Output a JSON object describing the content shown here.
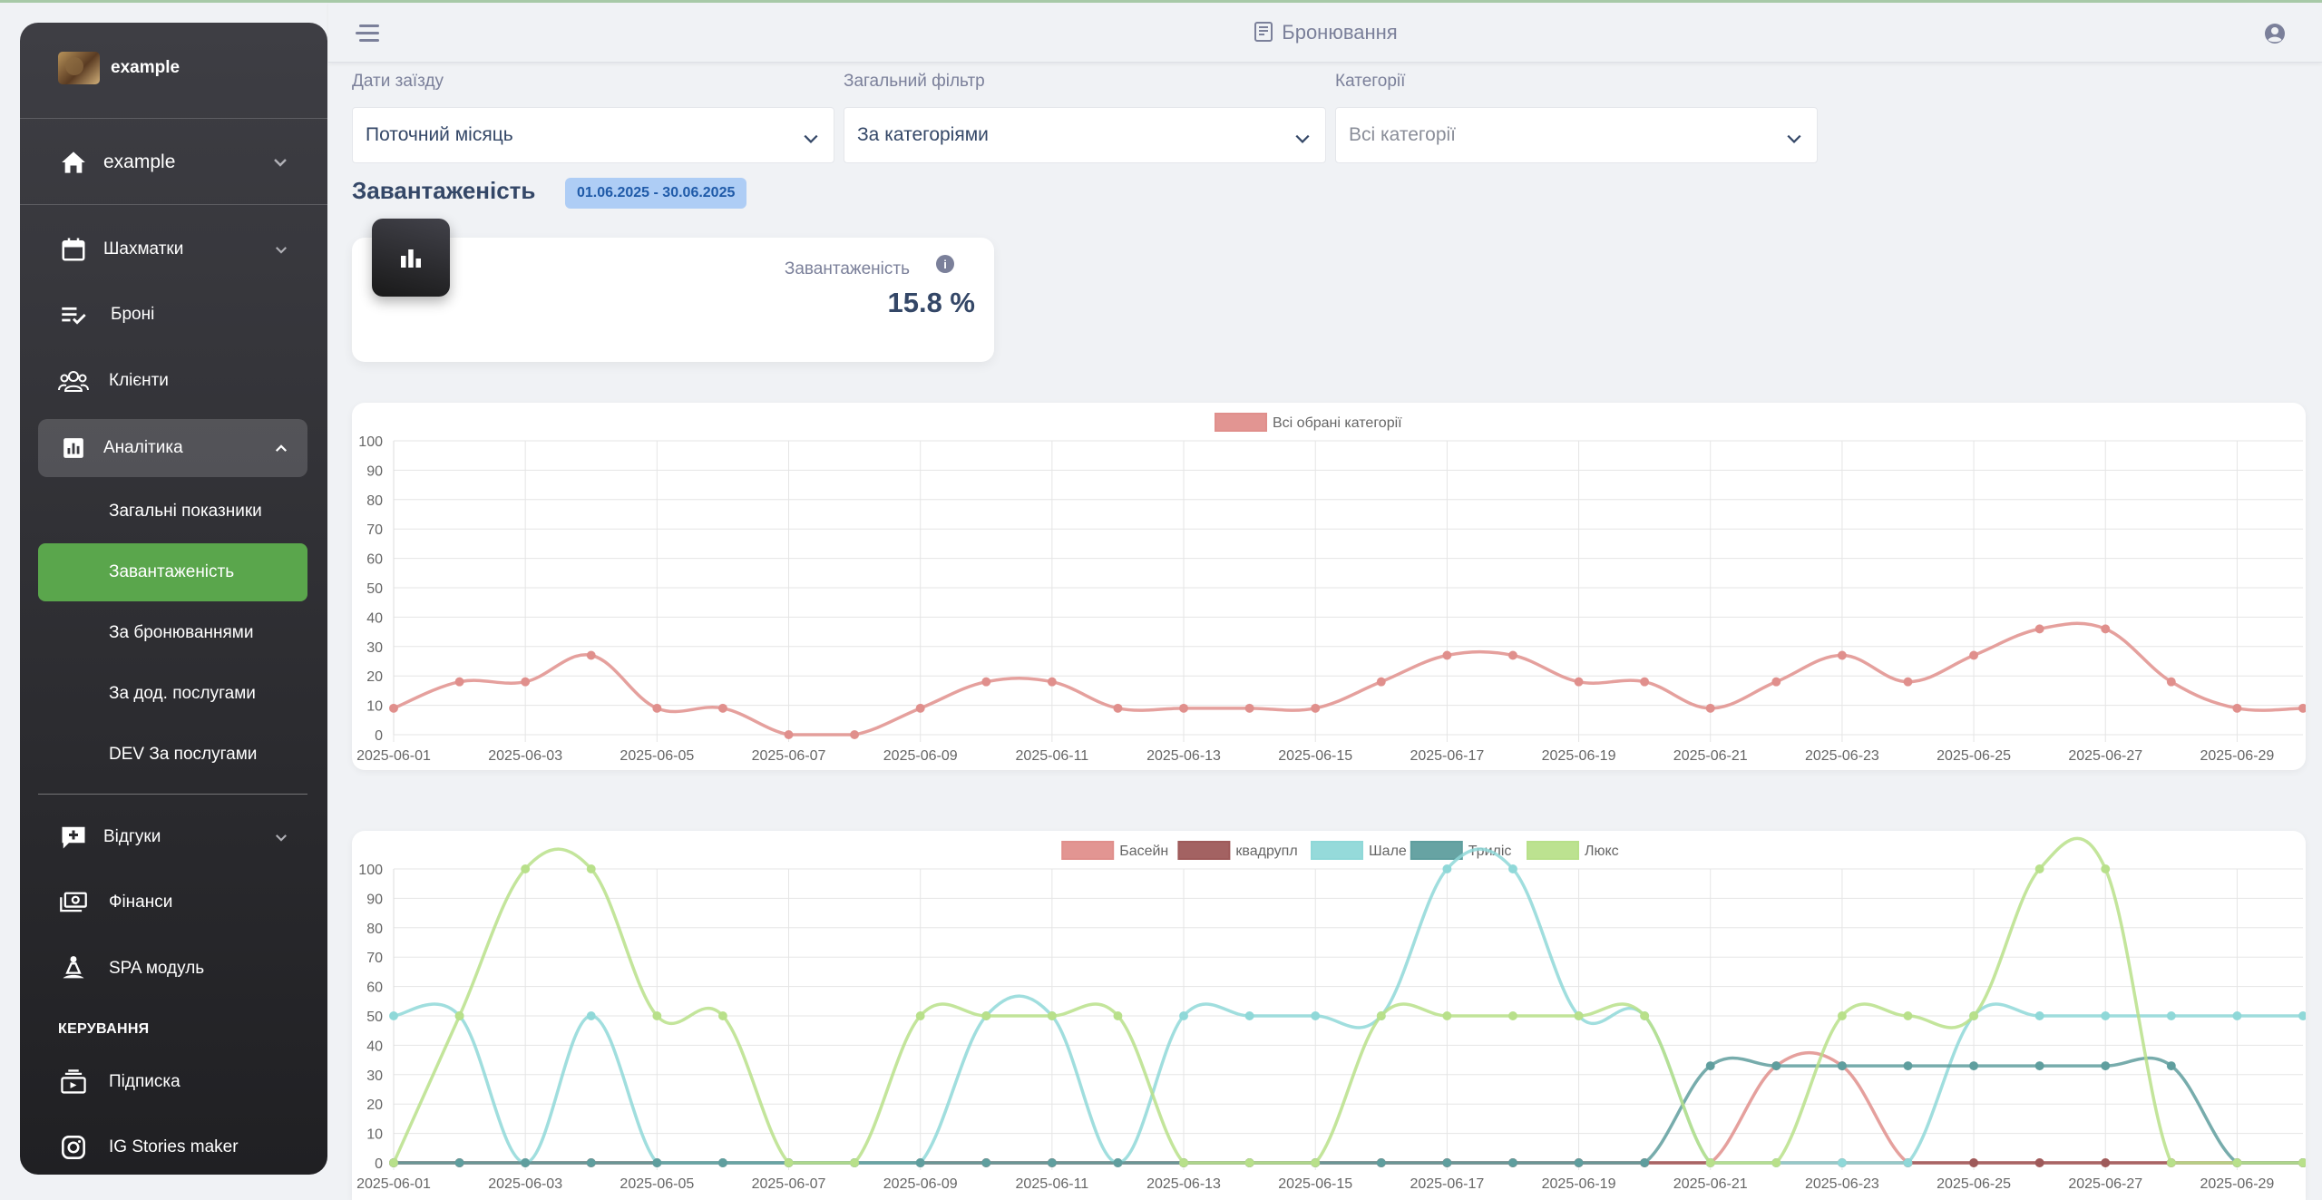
{
  "sidebar": {
    "brand": "example",
    "home_label": "example",
    "items": [
      {
        "label": "Шахматки",
        "icon": "calendar-icon"
      },
      {
        "label": "Броні",
        "icon": "checklist-icon"
      },
      {
        "label": "Клієнти",
        "icon": "clients-icon"
      },
      {
        "label": "Аналітика",
        "icon": "analytics-icon"
      }
    ],
    "analytics_sub": [
      {
        "label": "Загальні показники"
      },
      {
        "label": "Завантаженість"
      },
      {
        "label": "За бронюваннями"
      },
      {
        "label": "За дод. послугами"
      },
      {
        "label": "DEV За послугами"
      }
    ],
    "items2": [
      {
        "label": "Відгуки",
        "icon": "review-icon"
      },
      {
        "label": "Фінанси",
        "icon": "money-icon"
      },
      {
        "label": "SPA модуль",
        "icon": "spa-icon"
      }
    ],
    "section_manage": "КЕРУВАННЯ",
    "items3": [
      {
        "label": "Підписка",
        "icon": "subscription-icon"
      },
      {
        "label": "IG Stories maker",
        "icon": "instagram-icon"
      }
    ]
  },
  "header": {
    "title": "Бронювання"
  },
  "filters": {
    "dates": {
      "label": "Дати заїзду",
      "value": "Поточний місяць"
    },
    "general": {
      "label": "Загальний фільтр",
      "value": "За категоріями"
    },
    "categories": {
      "label": "Категорії",
      "placeholder": "Всі категорії"
    }
  },
  "section": {
    "title": "Завантаженість",
    "date_range": "01.06.2025 - 30.06.2025"
  },
  "stat": {
    "label": "Завантаженість",
    "info": "i",
    "value": "15.8 %"
  },
  "colors": {
    "accent": "#5aa64c",
    "badge_bg": "#aecdf5",
    "badge_text": "#1f5aa8"
  },
  "chart_data": [
    {
      "type": "line",
      "x": [
        "2025-06-01",
        "2025-06-02",
        "2025-06-03",
        "2025-06-04",
        "2025-06-05",
        "2025-06-06",
        "2025-06-07",
        "2025-06-08",
        "2025-06-09",
        "2025-06-10",
        "2025-06-11",
        "2025-06-12",
        "2025-06-13",
        "2025-06-14",
        "2025-06-15",
        "2025-06-16",
        "2025-06-17",
        "2025-06-18",
        "2025-06-19",
        "2025-06-20",
        "2025-06-21",
        "2025-06-22",
        "2025-06-23",
        "2025-06-24",
        "2025-06-25",
        "2025-06-26",
        "2025-06-27",
        "2025-06-28",
        "2025-06-29",
        "2025-06-30"
      ],
      "xticks": [
        "2025-06-01",
        "2025-06-03",
        "2025-06-05",
        "2025-06-07",
        "2025-06-09",
        "2025-06-11",
        "2025-06-13",
        "2025-06-15",
        "2025-06-17",
        "2025-06-19",
        "2025-06-21",
        "2025-06-23",
        "2025-06-25",
        "2025-06-27",
        "2025-06-29"
      ],
      "ylim": [
        0,
        100
      ],
      "yticks": [
        0,
        10,
        20,
        30,
        40,
        50,
        60,
        70,
        80,
        90,
        100
      ],
      "series": [
        {
          "name": "Всі обрані категорії",
          "color": "#e08f8c",
          "values": [
            9,
            18,
            18,
            27,
            9,
            9,
            0,
            0,
            9,
            18,
            18,
            9,
            9,
            9,
            9,
            18,
            27,
            27,
            18,
            18,
            9,
            18,
            27,
            18,
            27,
            36,
            36,
            18,
            9,
            9
          ]
        }
      ]
    },
    {
      "type": "line",
      "x": [
        "2025-06-01",
        "2025-06-02",
        "2025-06-03",
        "2025-06-04",
        "2025-06-05",
        "2025-06-06",
        "2025-06-07",
        "2025-06-08",
        "2025-06-09",
        "2025-06-10",
        "2025-06-11",
        "2025-06-12",
        "2025-06-13",
        "2025-06-14",
        "2025-06-15",
        "2025-06-16",
        "2025-06-17",
        "2025-06-18",
        "2025-06-19",
        "2025-06-20",
        "2025-06-21",
        "2025-06-22",
        "2025-06-23",
        "2025-06-24",
        "2025-06-25",
        "2025-06-26",
        "2025-06-27",
        "2025-06-28",
        "2025-06-29",
        "2025-06-30"
      ],
      "xticks": [
        "2025-06-01",
        "2025-06-03",
        "2025-06-05",
        "2025-06-07",
        "2025-06-09",
        "2025-06-11",
        "2025-06-13",
        "2025-06-15",
        "2025-06-17",
        "2025-06-19",
        "2025-06-21",
        "2025-06-23",
        "2025-06-25",
        "2025-06-27",
        "2025-06-29"
      ],
      "ylim": [
        0,
        100
      ],
      "yticks": [
        0,
        10,
        20,
        30,
        40,
        50,
        60,
        70,
        80,
        90,
        100
      ],
      "series": [
        {
          "name": "Басейн",
          "color": "#e08f8c",
          "values": [
            0,
            0,
            0,
            0,
            0,
            0,
            0,
            0,
            0,
            0,
            0,
            0,
            0,
            0,
            0,
            0,
            0,
            0,
            0,
            0,
            0,
            33,
            33,
            0,
            0,
            0,
            0,
            0,
            0,
            0
          ]
        },
        {
          "name": "квадрупл",
          "color": "#9e5a5a",
          "values": [
            0,
            0,
            0,
            0,
            0,
            0,
            0,
            0,
            0,
            0,
            0,
            0,
            0,
            0,
            0,
            0,
            0,
            0,
            0,
            0,
            0,
            0,
            0,
            0,
            0,
            0,
            0,
            0,
            0,
            0
          ]
        },
        {
          "name": "Шале",
          "color": "#8fd8d8",
          "values": [
            50,
            50,
            0,
            50,
            0,
            0,
            0,
            0,
            0,
            50,
            50,
            0,
            50,
            50,
            50,
            50,
            100,
            100,
            50,
            50,
            0,
            0,
            0,
            0,
            50,
            50,
            50,
            50,
            50,
            50
          ]
        },
        {
          "name": "Триліс",
          "color": "#5f9e9e",
          "values": [
            0,
            0,
            0,
            0,
            0,
            0,
            0,
            0,
            0,
            0,
            0,
            0,
            0,
            0,
            0,
            0,
            0,
            0,
            0,
            0,
            33,
            33,
            33,
            33,
            33,
            33,
            33,
            33,
            0,
            0
          ]
        },
        {
          "name": "Люкс",
          "color": "#b8e08a",
          "values": [
            0,
            50,
            100,
            100,
            50,
            50,
            0,
            0,
            50,
            50,
            50,
            50,
            0,
            0,
            0,
            50,
            50,
            50,
            50,
            50,
            0,
            0,
            50,
            50,
            50,
            100,
            100,
            0,
            0,
            0
          ]
        }
      ]
    }
  ]
}
